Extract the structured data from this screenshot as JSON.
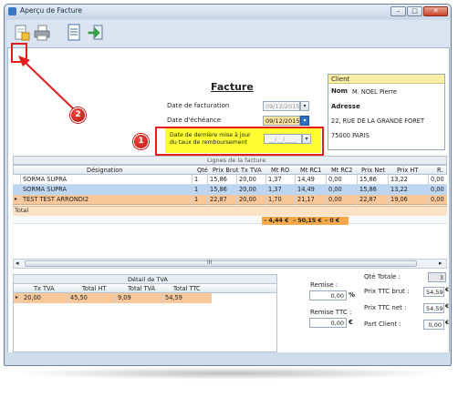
{
  "window": {
    "title": "Aperçu de Facture",
    "controls": [
      "–",
      "□",
      "✕"
    ]
  },
  "toolbar": {
    "icons": [
      "edit-document-icon",
      "printer-icon",
      "document-icon",
      "export-icon"
    ]
  },
  "invoice": {
    "heading": "Facture",
    "billing_date_label": "Date de facturation",
    "billing_date_value": "09/12/2015",
    "due_date_label": "Date d'échéance",
    "due_date_value": "09/12/2015",
    "rate_update_label_line1": "Date de dernière mise à jour",
    "rate_update_label_line2": "du taux de remboursement",
    "rate_update_value": "__/__/____"
  },
  "client": {
    "header": "Client",
    "name_label": "Nom",
    "name_value": "M. NOEL Pierre",
    "address_label": "Adresse",
    "address_line1": "22, RUE DE LA GRANDE FORET",
    "address_line2": "75000 PARIS"
  },
  "lines": {
    "title": "Lignes de la facture",
    "columns": [
      "Désignation",
      "Qté",
      "Prix Brut",
      "Tx TVA",
      "Mt RO",
      "Mt RC1",
      "Mt RC2",
      "Prix Net",
      "Prix HT",
      "R."
    ],
    "rows": [
      [
        "SORMA SUPRA",
        "1",
        "15,86",
        "20,00",
        "1,37",
        "14,49",
        "0,00",
        "15,86",
        "13,22",
        "0,00"
      ],
      [
        "SORMA SUPRA",
        "1",
        "15,86",
        "20,00",
        "1,37",
        "14,49",
        "0,00",
        "15,86",
        "13,22",
        "0,00"
      ],
      [
        "TEST TEST ARRONDI2",
        "1",
        "22,87",
        "20,00",
        "1,70",
        "21,17",
        "0,00",
        "22,87",
        "19,06",
        "0,00"
      ]
    ],
    "total_label": "Total",
    "total_values": [
      "– 4,44 €",
      "– 50,15 €",
      "– 0 €"
    ],
    "scroll_marker": "III"
  },
  "tva": {
    "title": "Détail de TVA",
    "columns": [
      "Tx TVA",
      "Total HT",
      "Total TVA",
      "Total TTC"
    ],
    "rows": [
      [
        "20,00",
        "45,50",
        "9,09",
        "54,59"
      ]
    ]
  },
  "summary": {
    "remise_label": "Remise :",
    "remise_value": "0,00",
    "remise_unit": "%",
    "remise_ttc_label": "Remise TTC :",
    "remise_ttc_value": "0,00",
    "remise_ttc_unit": "€",
    "qty_label": "Qté Totale :",
    "qty_value": "3",
    "brut_label": "Prix TTC brut :",
    "brut_value": "54,59",
    "net_label": "Prix TTC net :",
    "net_value": "54,59",
    "client_part_label": "Part Client :",
    "client_part_value": "0,00",
    "currency": "€"
  },
  "annotations": {
    "badge1": "1",
    "badge2": "2"
  },
  "colors": {
    "orange_row": "#f8c79a",
    "blue_row": "#bcd6f1",
    "highlight_yellow": "#ffff33",
    "annotation_red": "#e31d1d"
  }
}
